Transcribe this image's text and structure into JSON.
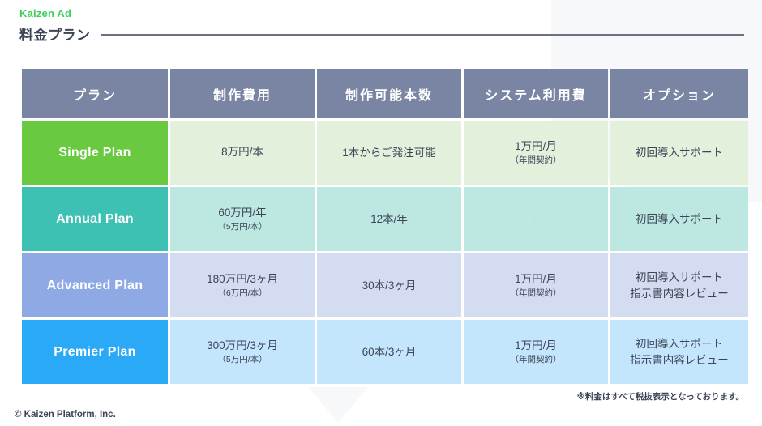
{
  "header": {
    "brand": "Kaizen Ad",
    "title": "料金プラン"
  },
  "table": {
    "columns": [
      "プラン",
      "制作費用",
      "制作可能本数",
      "システム利用費",
      "オプション"
    ],
    "rows": [
      {
        "plan": "Single Plan",
        "cost": "8万円/本",
        "cost_sub": "",
        "count": "1本からご発注可能",
        "system": "1万円/月",
        "system_sub": "（年間契約）",
        "option_line1": "初回導入サポート",
        "option_line2": ""
      },
      {
        "plan": "Annual Plan",
        "cost": "60万円/年",
        "cost_sub": "（5万円/本）",
        "count": "12本/年",
        "system": "-",
        "system_sub": "",
        "option_line1": "初回導入サポート",
        "option_line2": ""
      },
      {
        "plan": "Advanced Plan",
        "cost": "180万円/3ヶ月",
        "cost_sub": "（6万円/本）",
        "count": "30本/3ヶ月",
        "system": "1万円/月",
        "system_sub": "（年間契約）",
        "option_line1": "初回導入サポート",
        "option_line2": "指示書内容レビュー"
      },
      {
        "plan": "Premier Plan",
        "cost": "300万円/3ヶ月",
        "cost_sub": "（5万円/本）",
        "count": "60本/3ヶ月",
        "system": "1万円/月",
        "system_sub": "（年間契約）",
        "option_line1": "初回導入サポート",
        "option_line2": "指示書内容レビュー"
      }
    ]
  },
  "footnote": "※料金はすべて税抜表示となっております。",
  "footer": "© Kaizen Platform, Inc.",
  "colors": {
    "brand_green": "#3ecf5c",
    "header_slate": "#7a85a3",
    "single": "#69c941",
    "annual": "#3dc1b2",
    "advanced": "#8fa9e4",
    "premier": "#2aa9f7",
    "text_dark": "#3d4456"
  }
}
